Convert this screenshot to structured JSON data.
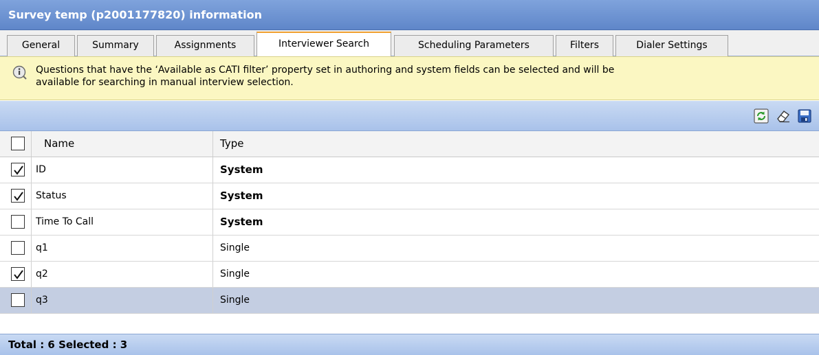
{
  "window": {
    "title": "Survey temp (p2001177820) information"
  },
  "tabs": [
    {
      "label": "General",
      "active": false
    },
    {
      "label": "Summary",
      "active": false
    },
    {
      "label": "Assignments",
      "active": false
    },
    {
      "label": "Interviewer Search",
      "active": true
    },
    {
      "label": "Scheduling Parameters",
      "active": false
    },
    {
      "label": "Filters",
      "active": false
    },
    {
      "label": "Dialer Settings",
      "active": false
    }
  ],
  "info": {
    "icon": "info-icon",
    "line1": "Questions that have the ‘Available as CATI filter’ property set in authoring and system fields can be selected and will be",
    "line2": "available for searching in manual interview selection."
  },
  "toolbar": {
    "buttons": [
      "refresh-icon",
      "eraser-icon",
      "save-icon"
    ]
  },
  "grid": {
    "header": {
      "name": "Name",
      "type": "Type"
    },
    "rows": [
      {
        "name": "ID",
        "type": "System",
        "checked": true,
        "bold": true
      },
      {
        "name": "Status",
        "type": "System",
        "checked": true,
        "bold": true
      },
      {
        "name": "Time To Call",
        "type": "System",
        "checked": false,
        "bold": true
      },
      {
        "name": "q1",
        "type": "Single",
        "checked": false,
        "bold": false
      },
      {
        "name": "q2",
        "type": "Single",
        "checked": true,
        "bold": false
      },
      {
        "name": "q3",
        "type": "Single",
        "checked": false,
        "bold": false,
        "highlighted": true
      }
    ]
  },
  "footer": {
    "text": "Total : 6 Selected : 3"
  },
  "colors": {
    "title_bar": "#6a8fd1",
    "active_tab_accent": "#f0a030",
    "info_bg": "#fbf7c2",
    "selected_row": "#c4cee2"
  }
}
